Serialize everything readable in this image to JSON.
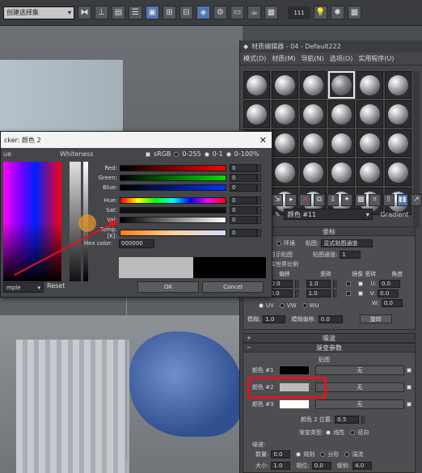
{
  "toolbar": {
    "selection_set": "创建选择集",
    "value": "111"
  },
  "material_editor": {
    "title": "材质编辑器 - 04 - Default222",
    "menu": [
      "模式(D)",
      "材质(M)",
      "导航(N)",
      "选项(O)",
      "实用程序(U)"
    ],
    "material_name": "颜色 #11",
    "map_type": "Gradient",
    "coordinates": {
      "header": "坐标",
      "texture_label": "纹理",
      "env_label": "环境",
      "mapping_label": "贴图:",
      "mapping_value": "显式贴图通道",
      "show_map_label": "在背面显示贴图",
      "map_channel_label": "贴图通道:",
      "map_channel_value": "1",
      "real_world_label": "使用真实世界比例",
      "offset_label": "偏移",
      "tiling_label": "瓷砖",
      "mirror_tile_label": "镜像 瓷砖",
      "angle_label": "角度",
      "u_label": "U:",
      "v_label": "V:",
      "w_label": "W:",
      "offset_u": "0.0",
      "offset_v": "0.0",
      "tiling_u": "1.0",
      "tiling_v": "1.0",
      "angle_u": "0.0",
      "angle_v": "0.0",
      "angle_w": "0.0",
      "uv_label": "UV",
      "vw_label": "VW",
      "wu_label": "WU",
      "blur_label": "模糊:",
      "blur_value": "1.0",
      "blur_offset_label": "模糊偏移:",
      "blur_offset_value": "0.0",
      "rotate_label": "旋转"
    },
    "noise_rollout": "噪波",
    "gradient_params": {
      "header": "渐变参数",
      "maps_label": "贴图",
      "color1_label": "颜色 #1",
      "color2_label": "颜色 #2",
      "color3_label": "颜色 #3",
      "none_label": "无",
      "color1_hex": "#000000",
      "color2_hex": "#bbbbbb",
      "color3_hex": "#ffffff",
      "color2_pos_label": "颜色 2 位置:",
      "color2_pos_value": "0.5",
      "gradient_type_label": "渐变类型:",
      "linear_label": "线性",
      "radial_label": "径向",
      "noise_label": "噪波:",
      "amount_label": "数量:",
      "amount_value": "0.0",
      "regular_label": "规则",
      "fractal_label": "分形",
      "turbulence_label": "湍流",
      "size_label": "大小:",
      "size_value": "1.0",
      "phase_label": "相位:",
      "phase_value": "0.0",
      "levels_label": "级别:",
      "levels_value": "4.0"
    }
  },
  "color_dialog": {
    "title": "cker: 颜色 2",
    "hue_label": "ue",
    "whiteness_label": "Whiteness",
    "srgb_label": "sRGB",
    "mode_0_255": "0-255",
    "mode_0_1": "0-1",
    "mode_0_100": "0-100%",
    "channels": [
      {
        "label": "Red:",
        "value": "0"
      },
      {
        "label": "Green:",
        "value": "0"
      },
      {
        "label": "Blue:",
        "value": "0"
      },
      {
        "label": "Hue:",
        "value": "0"
      },
      {
        "label": "Sat:",
        "value": "0"
      },
      {
        "label": "Val:",
        "value": "0"
      },
      {
        "label": "Temp. [K]:",
        "value": "0"
      }
    ],
    "hex_label": "Hex color:",
    "hex_value": "000000",
    "sample_label": "mple",
    "reset_label": "Reset",
    "ok_label": "OK",
    "cancel_label": "Cancel"
  }
}
